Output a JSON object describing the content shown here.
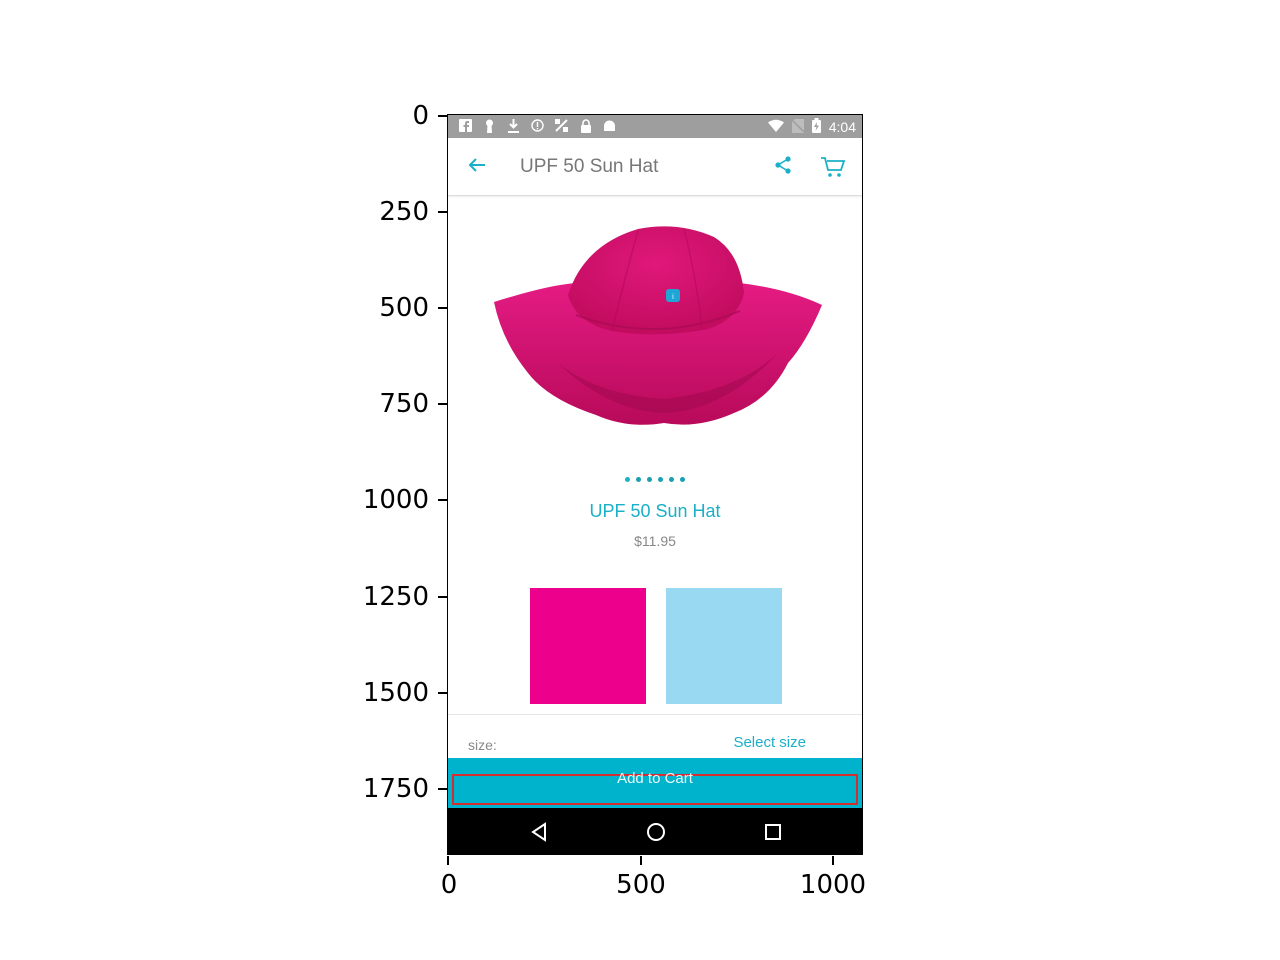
{
  "axes": {
    "y_ticks": [
      "0",
      "250",
      "500",
      "750",
      "1000",
      "1250",
      "1500",
      "1750"
    ],
    "x_ticks": [
      "0",
      "500",
      "1000"
    ]
  },
  "statusbar": {
    "time": "4:04",
    "left_icons": [
      "facebook-icon",
      "keyhole-icon",
      "download-icon",
      "info-icon",
      "satellite-icon",
      "lock-icon",
      "android-icon"
    ],
    "right_icons": [
      "wifi-icon",
      "no-sim-icon",
      "battery-charging-icon"
    ]
  },
  "appbar": {
    "title": "UPF 50 Sun Hat",
    "icons": [
      "back-arrow-icon",
      "share-icon",
      "cart-icon"
    ]
  },
  "product": {
    "image": "hat-image",
    "carousel_dots": 6,
    "name": "UPF 50 Sun Hat",
    "price": "$11.95",
    "colors": [
      "#ec008c",
      "#99d9f2"
    ]
  },
  "size": {
    "label": "size:",
    "select_label": "Select size"
  },
  "cart": {
    "button_label": "Add to Cart",
    "highlight_color": "#d32f2f",
    "bar_color": "#00b3cc"
  },
  "navbar": {
    "icons": [
      "nav-back-icon",
      "nav-home-icon",
      "nav-recents-icon"
    ]
  }
}
